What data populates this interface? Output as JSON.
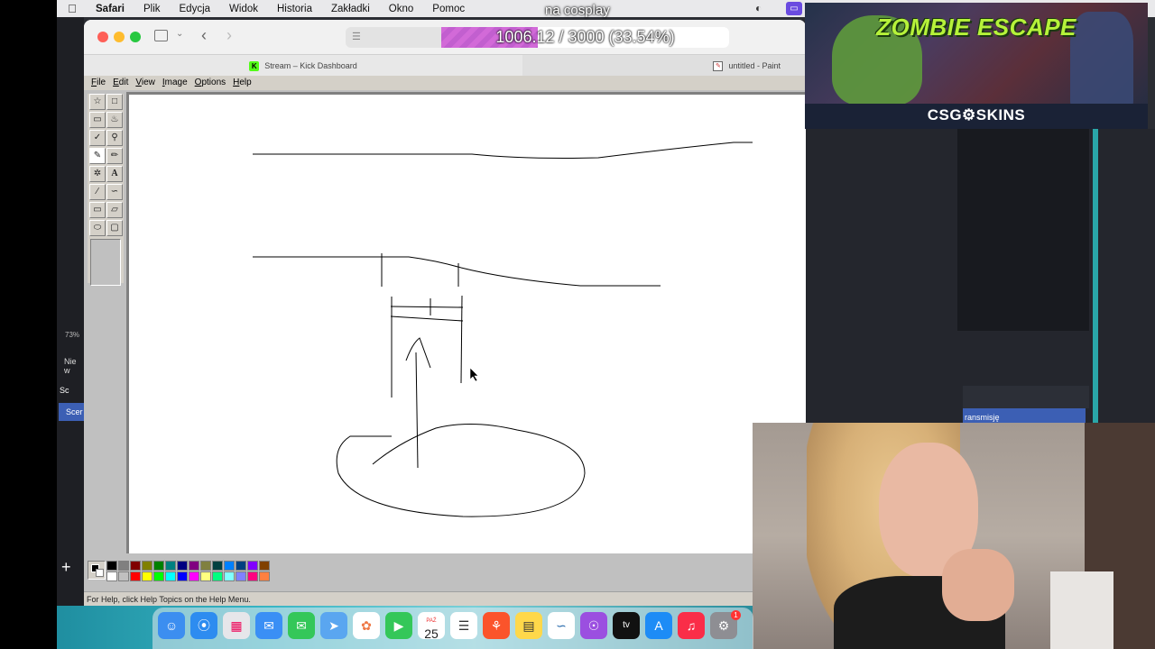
{
  "menubar": {
    "app": "Safari",
    "items": [
      "Plik",
      "Edycja",
      "Widok",
      "Historia",
      "Zakładki",
      "Okno",
      "Pomoc"
    ],
    "overlay_text": "na cosplay"
  },
  "obs_left": {
    "zoom": "73%",
    "label_nie": "Nie w",
    "label_sc": "Sc",
    "label_scene": "Scer"
  },
  "safari": {
    "progress_text": "1006.12 / 3000 (33.54%)",
    "progress_fraction": 0.3354,
    "tabs": [
      {
        "label": "Stream – Kick Dashboard",
        "favicon": "K"
      },
      {
        "label": "untitled - Paint"
      }
    ]
  },
  "paint": {
    "menu": [
      "File",
      "Edit",
      "View",
      "Image",
      "Options",
      "Help"
    ],
    "status": "For Help, click Help Topics on the Help Menu.",
    "palette": [
      "#000000",
      "#808080",
      "#800000",
      "#808000",
      "#008000",
      "#008080",
      "#000080",
      "#800080",
      "#808040",
      "#004040",
      "#0080ff",
      "#004080",
      "#8000ff",
      "#804000",
      "#ffffff",
      "#c0c0c0",
      "#ff0000",
      "#ffff00",
      "#00ff00",
      "#00ffff",
      "#0000ff",
      "#ff00ff",
      "#ffff80",
      "#00ff80",
      "#80ffff",
      "#8080ff",
      "#ff0080",
      "#ff8040"
    ]
  },
  "banner": {
    "title": "ZOMBIE ESCAPE",
    "brand": "CSG⚙SKINS"
  },
  "obs_right": {
    "stream_button": "ransmisję"
  },
  "dock": {
    "calendar_month": "PAŹ",
    "calendar_day": "25",
    "badge": "1"
  }
}
